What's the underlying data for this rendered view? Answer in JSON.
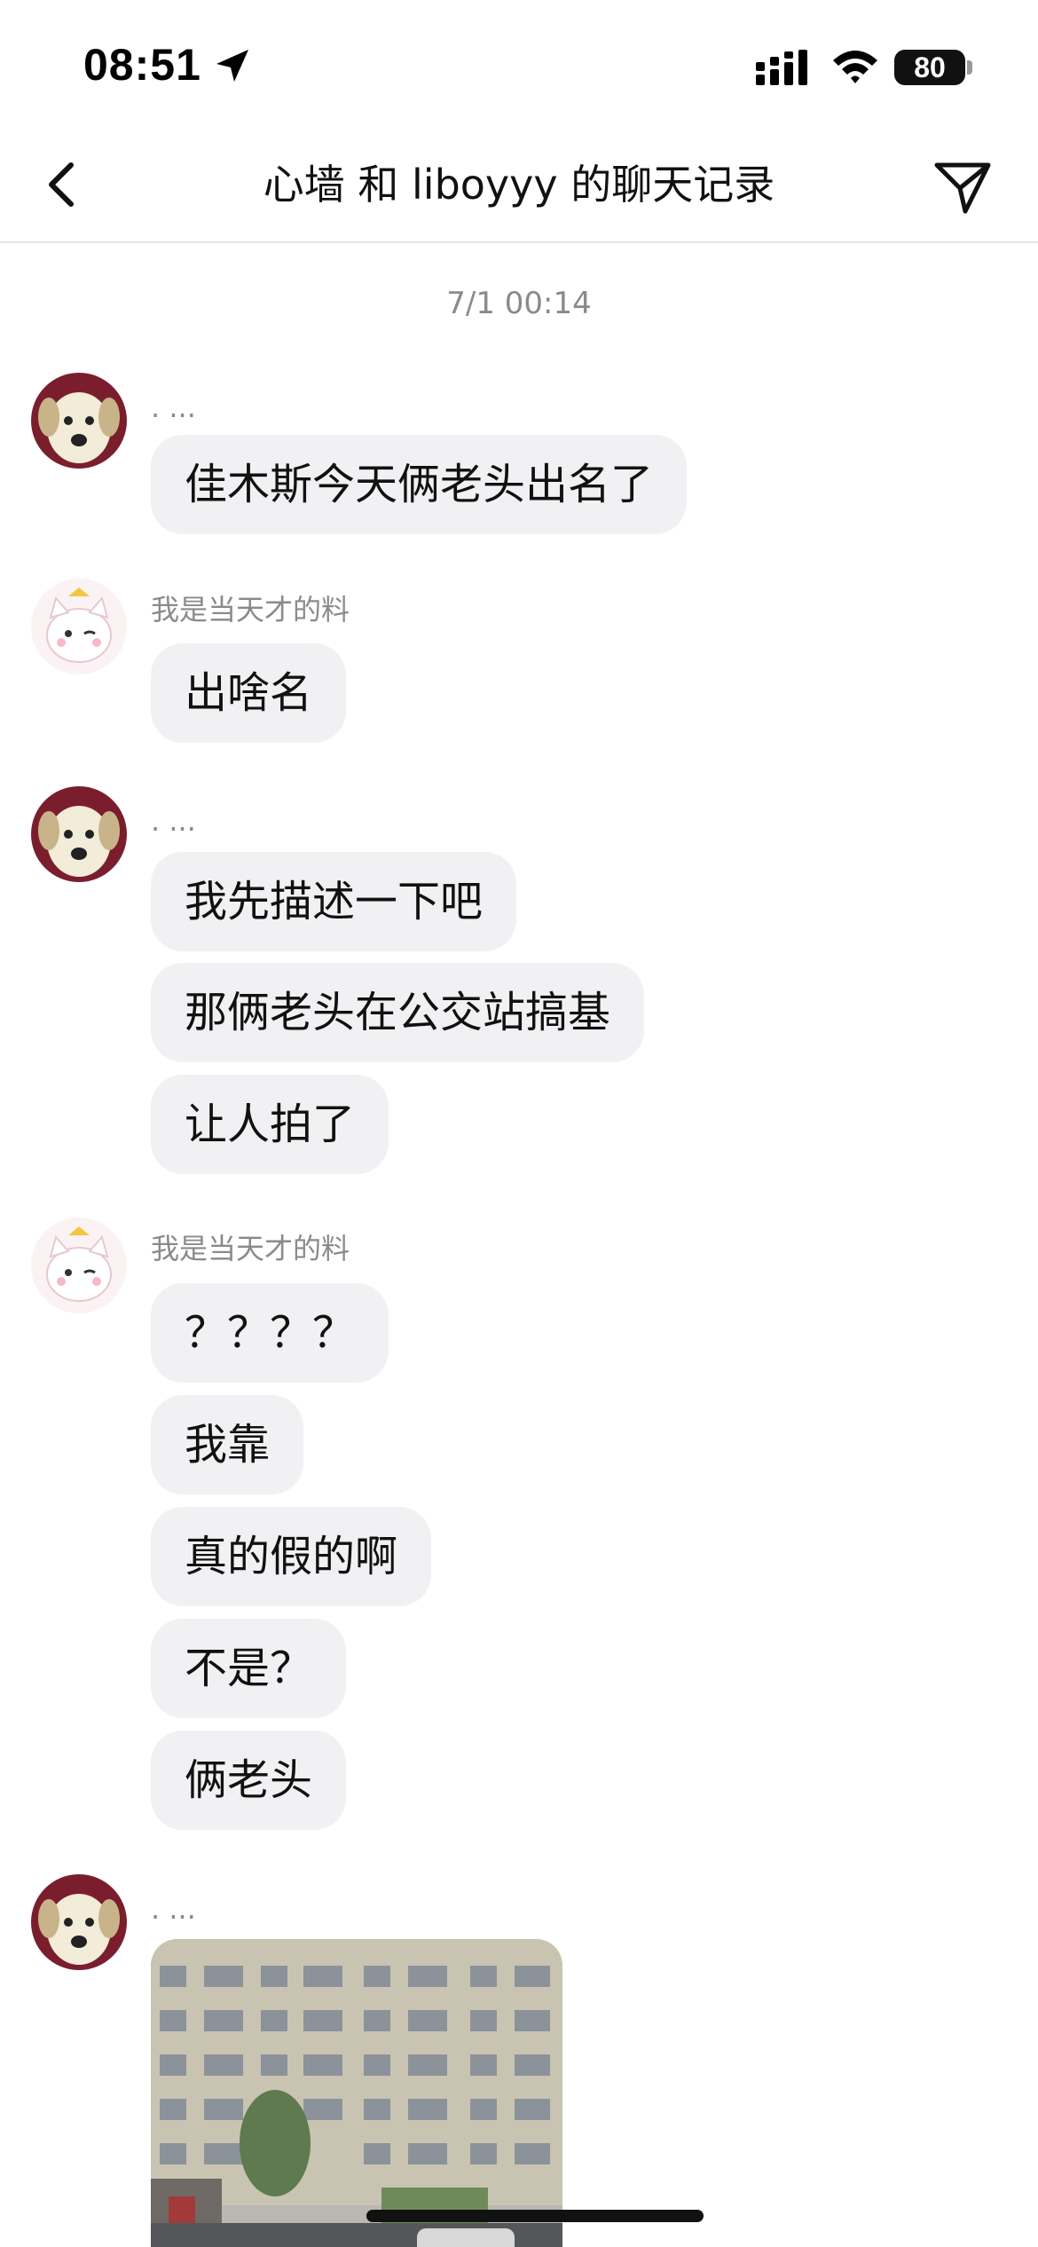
{
  "status_bar": {
    "time": "08:51",
    "battery": "80",
    "icons": [
      "location-arrow-icon",
      "cellular-signal-icon",
      "wifi-icon",
      "battery-icon"
    ]
  },
  "nav": {
    "title": "心墙 和 liboyyy 的聊天记录",
    "back_icon": "chevron-left-icon",
    "share_icon": "paper-plane-icon"
  },
  "chat": {
    "timestamp": "7/1 00:14",
    "groups": [
      {
        "sender": ". ...",
        "avatar": "dog-avatar",
        "messages": [
          "佳木斯今天俩老头出名了"
        ]
      },
      {
        "sender": "我是当天才的料",
        "avatar": "cat-avatar",
        "messages": [
          "出啥名"
        ]
      },
      {
        "sender": ". ...",
        "avatar": "dog-avatar",
        "messages": [
          "我先描述一下吧",
          "那俩老头在公交站搞基",
          "让人拍了"
        ]
      },
      {
        "sender": "我是当天才的料",
        "avatar": "cat-avatar",
        "messages": [
          "？？？？",
          "我靠",
          "真的假的啊",
          "不是？",
          "俩老头"
        ]
      },
      {
        "sender": ". ...",
        "avatar": "dog-avatar",
        "messages": [],
        "image": "building-street-photo"
      }
    ]
  },
  "colors": {
    "bubble": "#f1f1f3",
    "secondary_text": "#8a8a8a",
    "divider": "#e6e6e6"
  }
}
